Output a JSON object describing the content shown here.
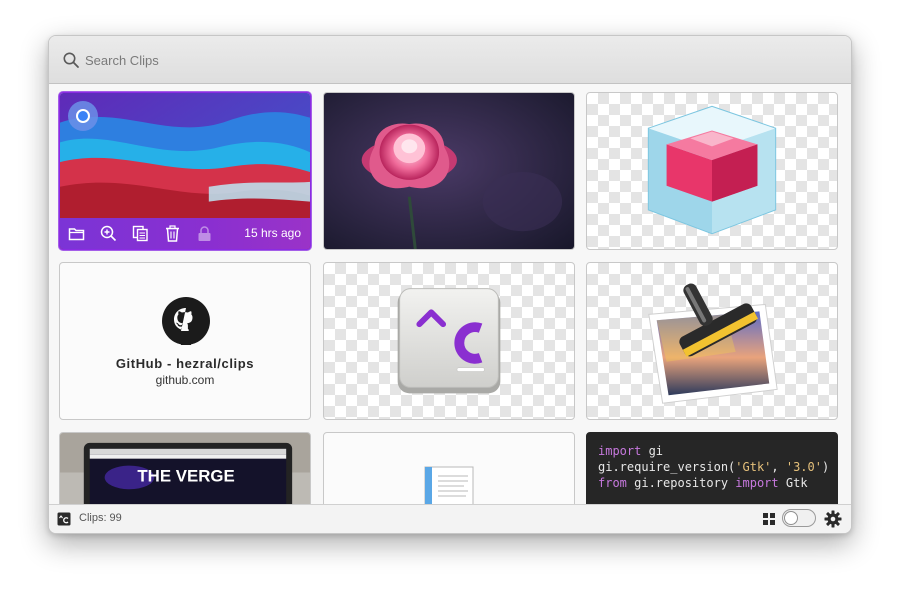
{
  "search": {
    "placeholder": "Search Clips",
    "value": ""
  },
  "clips": [
    {
      "kind": "image",
      "description": "Colorful wavy wallpaper",
      "selected": true,
      "time": "15 hrs ago"
    },
    {
      "kind": "image",
      "description": "Pink dahlia flower photo"
    },
    {
      "kind": "image",
      "description": "Glossy pink cube icon"
    },
    {
      "kind": "link",
      "title": "GitHub - hezral/clips",
      "url": "github.com",
      "icon": "github-icon"
    },
    {
      "kind": "image",
      "description": "Clips app icon"
    },
    {
      "kind": "image",
      "description": "Photo editor icon with brush"
    },
    {
      "kind": "image",
      "description": "The Verge website on laptop",
      "brand": "THE VERGE"
    },
    {
      "kind": "file",
      "description": "Document thumbnail"
    },
    {
      "kind": "code",
      "language": "python",
      "lines": [
        {
          "tokens": [
            {
              "t": "import",
              "c": "kw"
            },
            {
              "t": " gi",
              "c": ""
            }
          ]
        },
        {
          "tokens": [
            {
              "t": "gi.require_version(",
              "c": ""
            },
            {
              "t": "'Gtk'",
              "c": "str"
            },
            {
              "t": ", ",
              "c": ""
            },
            {
              "t": "'3.0'",
              "c": "str"
            },
            {
              "t": ")",
              "c": ""
            }
          ]
        },
        {
          "tokens": [
            {
              "t": "from",
              "c": "kw"
            },
            {
              "t": " gi.repository ",
              "c": ""
            },
            {
              "t": "import",
              "c": "kw"
            },
            {
              "t": " Gtk",
              "c": ""
            }
          ]
        }
      ]
    }
  ],
  "clip_actions": [
    "folder-icon",
    "zoom-in-icon",
    "copy-icon",
    "trash-icon",
    "lock-icon"
  ],
  "footer": {
    "clips_label": "Clips: 99",
    "icons": [
      "clips-app-icon",
      "grid-view-icon",
      "settings-gear-icon"
    ],
    "toggle_on": false
  },
  "colors": {
    "accent": "#8a2fd0",
    "header": "#e4e4e4",
    "code_bg": "#262626"
  }
}
